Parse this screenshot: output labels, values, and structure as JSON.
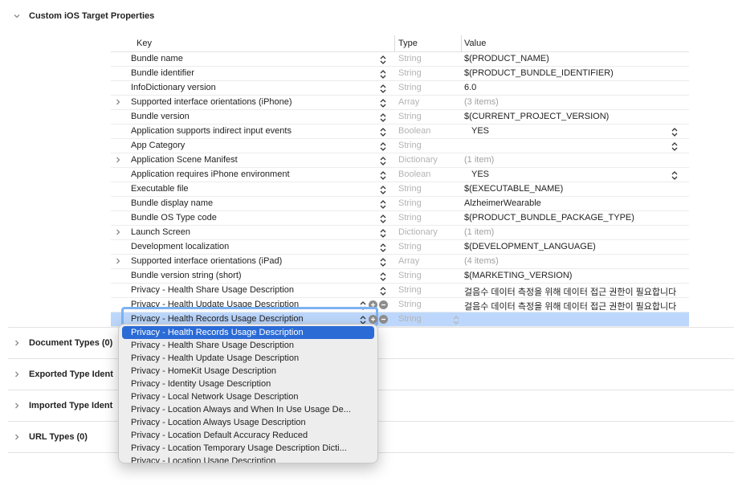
{
  "section_title": "Custom iOS Target Properties",
  "columns": {
    "key": "Key",
    "type": "Type",
    "value": "Value"
  },
  "rows": [
    {
      "key": "Bundle name",
      "type": "String",
      "value": "$(PRODUCT_NAME)",
      "expandable": false,
      "value_muted": false,
      "value_stepper": false
    },
    {
      "key": "Bundle identifier",
      "type": "String",
      "value": "$(PRODUCT_BUNDLE_IDENTIFIER)",
      "expandable": false,
      "value_muted": false,
      "value_stepper": false
    },
    {
      "key": "InfoDictionary version",
      "type": "String",
      "value": "6.0",
      "expandable": false,
      "value_muted": false,
      "value_stepper": false
    },
    {
      "key": "Supported interface orientations (iPhone)",
      "type": "Array",
      "value": "(3 items)",
      "expandable": true,
      "value_muted": true,
      "value_stepper": false
    },
    {
      "key": "Bundle version",
      "type": "String",
      "value": "$(CURRENT_PROJECT_VERSION)",
      "expandable": false,
      "value_muted": false,
      "value_stepper": false
    },
    {
      "key": "Application supports indirect input events",
      "type": "Boolean",
      "value": "YES",
      "expandable": false,
      "value_muted": false,
      "value_stepper": true
    },
    {
      "key": "App Category",
      "type": "String",
      "value": "",
      "expandable": false,
      "value_muted": false,
      "value_stepper": true
    },
    {
      "key": "Application Scene Manifest",
      "type": "Dictionary",
      "value": "(1 item)",
      "expandable": true,
      "value_muted": true,
      "value_stepper": false
    },
    {
      "key": "Application requires iPhone environment",
      "type": "Boolean",
      "value": "YES",
      "expandable": false,
      "value_muted": false,
      "value_stepper": true
    },
    {
      "key": "Executable file",
      "type": "String",
      "value": "$(EXECUTABLE_NAME)",
      "expandable": false,
      "value_muted": false,
      "value_stepper": false
    },
    {
      "key": "Bundle display name",
      "type": "String",
      "value": "AlzheimerWearable",
      "expandable": false,
      "value_muted": false,
      "value_stepper": false
    },
    {
      "key": "Bundle OS Type code",
      "type": "String",
      "value": "$(PRODUCT_BUNDLE_PACKAGE_TYPE)",
      "expandable": false,
      "value_muted": false,
      "value_stepper": false
    },
    {
      "key": "Launch Screen",
      "type": "Dictionary",
      "value": "(1 item)",
      "expandable": true,
      "value_muted": true,
      "value_stepper": false
    },
    {
      "key": "Development localization",
      "type": "String",
      "value": "$(DEVELOPMENT_LANGUAGE)",
      "expandable": false,
      "value_muted": false,
      "value_stepper": false
    },
    {
      "key": "Supported interface orientations (iPad)",
      "type": "Array",
      "value": "(4 items)",
      "expandable": true,
      "value_muted": true,
      "value_stepper": false
    },
    {
      "key": "Bundle version string (short)",
      "type": "String",
      "value": "$(MARKETING_VERSION)",
      "expandable": false,
      "value_muted": false,
      "value_stepper": false
    },
    {
      "key": "Privacy - Health Share Usage Description",
      "type": "String",
      "value": "걸음수 데이터 측정을 위해 데이터 접근 권한이 필요합니다",
      "expandable": false,
      "value_muted": false,
      "value_stepper": false
    },
    {
      "key": "Privacy - Health Update Usage Description",
      "type": "String",
      "value": "걸음수 데이터 측정을 위해 데이터 접근 권한이 필요합니다",
      "expandable": false,
      "value_muted": false,
      "value_stepper": false,
      "show_addrm": true
    }
  ],
  "editing_row": {
    "key_prefix": "Privacy - Heal",
    "key_selected": "th Records Usage Description",
    "type": "String"
  },
  "lower_sections": [
    {
      "title": "Document Types (0)"
    },
    {
      "title": "Exported Type Ident"
    },
    {
      "title": "Imported Type Ident"
    },
    {
      "title": "URL Types (0)"
    }
  ],
  "popup": {
    "items": [
      "Privacy - Health Records Usage Description",
      "Privacy - Health Share Usage Description",
      "Privacy - Health Update Usage Description",
      "Privacy - HomeKit Usage Description",
      "Privacy - Identity Usage Description",
      "Privacy - Local Network Usage Description",
      "Privacy - Location Always and When In Use Usage De...",
      "Privacy - Location Always Usage Description",
      "Privacy - Location Default Accuracy Reduced",
      "Privacy - Location Temporary Usage Description Dicti...",
      "Privacy - Location Usage Description"
    ],
    "highlighted_index": 0
  },
  "colors": {
    "selection": "#2a6bd6",
    "row_selected": "#bcd7fb",
    "type_text": "#b3b3b3"
  },
  "icons": {
    "disclosure": "chevron-right-icon",
    "expanded": "chevron-down-icon",
    "stepper": "up-down-stepper-icon",
    "add": "plus-circle-icon",
    "remove": "minus-circle-icon"
  }
}
